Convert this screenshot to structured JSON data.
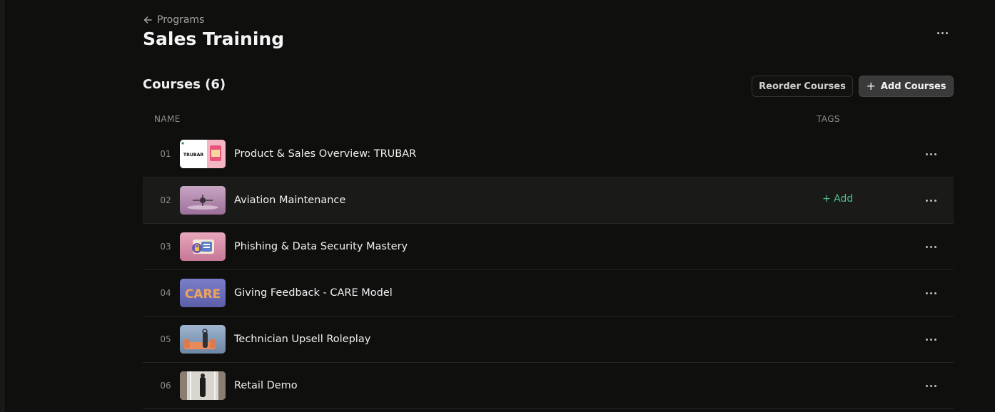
{
  "breadcrumb": {
    "label": "Programs",
    "icon": "arrow-left-icon"
  },
  "page": {
    "title": "Sales Training"
  },
  "courses": {
    "heading": "Courses (6)",
    "reorder_label": "Reorder Courses",
    "add_label": "Add Courses",
    "columns": {
      "name": "NAME",
      "tags": "TAGS"
    },
    "add_tag_label": "+ Add",
    "rows": [
      {
        "num": "01",
        "title": "Product & Sales Overview: TRUBAR",
        "thumb_text": "TRUBAR"
      },
      {
        "num": "02",
        "title": "Aviation Maintenance"
      },
      {
        "num": "03",
        "title": "Phishing & Data Security Mastery"
      },
      {
        "num": "04",
        "title": "Giving Feedback - CARE Model",
        "thumb_text": "CARE"
      },
      {
        "num": "05",
        "title": "Technician Upsell Roleplay"
      },
      {
        "num": "06",
        "title": "Retail Demo"
      }
    ]
  },
  "colors": {
    "background": "#0f0f0e",
    "accent_green": "#4fbf86",
    "add_button": "#3a3a3a"
  }
}
